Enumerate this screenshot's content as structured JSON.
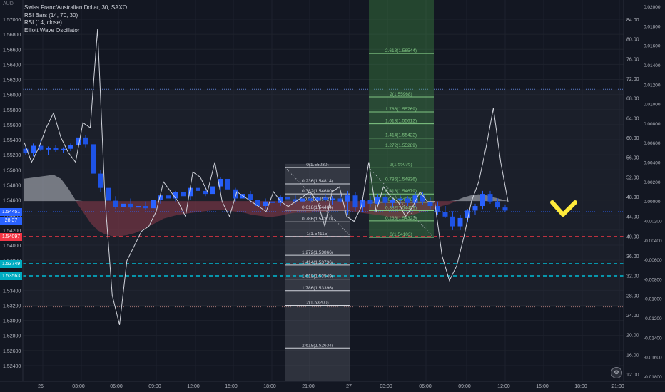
{
  "window": {
    "unit_label": "AUD"
  },
  "legend": {
    "symbol": "Swiss Franc/Australian Dollar, 30, SAXO",
    "indicators": [
      "RSI Bars (14, 70, 30)",
      "RSI (14, close)",
      "Elliott Wave Oscillator"
    ]
  },
  "price_tags": {
    "current": "1.54451",
    "countdown": "28:37",
    "red_level": "1.54097",
    "cyan1": "1.53749",
    "cyan2": "1.53563"
  },
  "colors": {
    "background": "#131722",
    "bull": "#2962ff",
    "bear": "#1e53e5",
    "red_line": "#f23645",
    "cyan_line": "#00bcd4",
    "fib_green": "#81c784",
    "fib_white": "#d1d4dc",
    "check_mark": "#ffeb3b"
  },
  "chart_data": {
    "type": "candlestick",
    "price_axis": {
      "min": 1.522,
      "max": 1.572,
      "ticks": [
        "1.57000",
        "1.56800",
        "1.56600",
        "1.56400",
        "1.56200",
        "1.56000",
        "1.55800",
        "1.55600",
        "1.55400",
        "1.55200",
        "1.55000",
        "1.54800",
        "1.54600",
        "1.54400",
        "1.54200",
        "1.54000",
        "1.53800",
        "1.53600",
        "1.53400",
        "1.53200",
        "1.53000",
        "1.52800",
        "1.52600",
        "1.52400"
      ]
    },
    "rsi_axis": {
      "ticks": [
        "84.00",
        "80.00",
        "76.00",
        "72.00",
        "68.00",
        "64.00",
        "60.00",
        "56.00",
        "52.00",
        "48.00",
        "44.00",
        "40.00",
        "36.00",
        "32.00",
        "28.00",
        "24.00",
        "20.00",
        "16.00",
        "12.00"
      ]
    },
    "osc_axis": {
      "ticks": [
        "0.02000",
        "0.01800",
        "0.01600",
        "0.01400",
        "0.01200",
        "0.01000",
        "0.00800",
        "0.00600",
        "0.00400",
        "0.00200",
        "0.00000",
        "-0.00200",
        "-0.00400",
        "-0.00600",
        "-0.00800",
        "-0.01000",
        "-0.01200",
        "-0.01400",
        "-0.01600",
        "-0.01800"
      ]
    },
    "time_axis": [
      "26",
      "03:00",
      "06:00",
      "09:00",
      "12:00",
      "15:00",
      "18:00",
      "21:00",
      "27",
      "03:00",
      "06:00",
      "09:00",
      "12:00",
      "15:00",
      "18:00",
      "21:00"
    ],
    "candles": [
      [
        1.5528,
        1.5532,
        1.552,
        1.5522
      ],
      [
        1.5522,
        1.5535,
        1.5518,
        1.5532
      ],
      [
        1.5532,
        1.554,
        1.5525,
        1.5527
      ],
      [
        1.5527,
        1.5531,
        1.552,
        1.5529
      ],
      [
        1.5529,
        1.5533,
        1.5524,
        1.5526
      ],
      [
        1.5526,
        1.553,
        1.5522,
        1.5528
      ],
      [
        1.5528,
        1.5535,
        1.5525,
        1.5533
      ],
      [
        1.5533,
        1.5545,
        1.553,
        1.5543
      ],
      [
        1.5543,
        1.5546,
        1.553,
        1.5534
      ],
      [
        1.5534,
        1.5536,
        1.549,
        1.5495
      ],
      [
        1.5495,
        1.55,
        1.547,
        1.5476
      ],
      [
        1.5476,
        1.548,
        1.5455,
        1.5459
      ],
      [
        1.5459,
        1.5465,
        1.5448,
        1.5451
      ],
      [
        1.5451,
        1.546,
        1.5445,
        1.5455
      ],
      [
        1.5455,
        1.5462,
        1.5448,
        1.545
      ],
      [
        1.545,
        1.5456,
        1.5442,
        1.5452
      ],
      [
        1.5452,
        1.5458,
        1.5447,
        1.5449
      ],
      [
        1.5449,
        1.5462,
        1.5446,
        1.546
      ],
      [
        1.546,
        1.5468,
        1.5455,
        1.5466
      ],
      [
        1.5466,
        1.547,
        1.5458,
        1.5462
      ],
      [
        1.5462,
        1.5472,
        1.5458,
        1.547
      ],
      [
        1.547,
        1.5475,
        1.5462,
        1.5465
      ],
      [
        1.5465,
        1.5478,
        1.546,
        1.5476
      ],
      [
        1.5476,
        1.5482,
        1.5468,
        1.5472
      ],
      [
        1.5472,
        1.5478,
        1.5465,
        1.5468
      ],
      [
        1.5468,
        1.548,
        1.5465,
        1.5478
      ],
      [
        1.5478,
        1.549,
        1.547,
        1.5488
      ],
      [
        1.5488,
        1.5492,
        1.547,
        1.5474
      ],
      [
        1.5474,
        1.5476,
        1.5458,
        1.5462
      ],
      [
        1.5462,
        1.5472,
        1.5455,
        1.5468
      ],
      [
        1.5468,
        1.5472,
        1.5456,
        1.546
      ],
      [
        1.546,
        1.5465,
        1.5448,
        1.5452
      ],
      [
        1.5452,
        1.5462,
        1.5448,
        1.5458
      ],
      [
        1.5458,
        1.5464,
        1.545,
        1.5456
      ],
      [
        1.5456,
        1.5466,
        1.5452,
        1.5464
      ],
      [
        1.5464,
        1.547,
        1.5458,
        1.5461
      ],
      [
        1.5461,
        1.5466,
        1.5455,
        1.5458
      ],
      [
        1.5458,
        1.5464,
        1.5454,
        1.5462
      ],
      [
        1.5462,
        1.5467,
        1.5456,
        1.5459
      ],
      [
        1.5459,
        1.5466,
        1.5455,
        1.5463
      ],
      [
        1.5463,
        1.5468,
        1.5458,
        1.546
      ],
      [
        1.546,
        1.5465,
        1.5454,
        1.5462
      ],
      [
        1.5462,
        1.5468,
        1.5456,
        1.5458
      ],
      [
        1.5458,
        1.5472,
        1.544,
        1.5466
      ],
      [
        1.5466,
        1.547,
        1.5445,
        1.545
      ],
      [
        1.545,
        1.5462,
        1.5444,
        1.546
      ],
      [
        1.546,
        1.5465,
        1.545,
        1.5455
      ],
      [
        1.5455,
        1.5468,
        1.5452,
        1.5464
      ],
      [
        1.5464,
        1.5468,
        1.5452,
        1.5456
      ],
      [
        1.5456,
        1.5462,
        1.545,
        1.546
      ],
      [
        1.546,
        1.5466,
        1.5455,
        1.5462
      ],
      [
        1.5462,
        1.5465,
        1.5452,
        1.5456
      ],
      [
        1.5456,
        1.547,
        1.545,
        1.5466
      ],
      [
        1.5466,
        1.547,
        1.5454,
        1.5458
      ],
      [
        1.5458,
        1.5463,
        1.5448,
        1.5452
      ],
      [
        1.5452,
        1.5458,
        1.544,
        1.5444
      ],
      [
        1.5444,
        1.5452,
        1.5436,
        1.5438
      ],
      [
        1.5438,
        1.5445,
        1.542,
        1.5425
      ],
      [
        1.5425,
        1.544,
        1.542,
        1.5436
      ],
      [
        1.5436,
        1.5448,
        1.543,
        1.5446
      ],
      [
        1.5446,
        1.5455,
        1.544,
        1.5452
      ],
      [
        1.5452,
        1.5472,
        1.5448,
        1.5468
      ],
      [
        1.5468,
        1.5472,
        1.5455,
        1.5458
      ],
      [
        1.5458,
        1.5462,
        1.5448,
        1.545
      ],
      [
        1.545,
        1.5454,
        1.5444,
        1.5446
      ]
    ],
    "fib_left": {
      "levels": [
        [
          "0(1.55030)",
          1.5503
        ],
        [
          "0.236(1.54814)",
          1.54814
        ],
        [
          "0.382(1.54680)",
          1.5468
        ],
        [
          "0.5(1.54572)",
          1.54572
        ],
        [
          "0.618(1.54464)",
          1.54464
        ],
        [
          "0.786(1.54310)",
          1.5431
        ],
        [
          "1(1.54115)",
          1.54115
        ],
        [
          "1.272(1.53866)",
          1.53866
        ],
        [
          "1.414(1.53736)",
          1.53736
        ],
        [
          "1.618(1.53549)",
          1.53549
        ],
        [
          "1.786(1.53396)",
          1.53396
        ],
        [
          "2(1.53200)",
          1.532
        ],
        [
          "2.618(1.52634)",
          1.52634
        ]
      ]
    },
    "fib_right": {
      "levels": [
        [
          "2.618(1.56544)",
          1.56544
        ],
        [
          "2(1.55968)",
          1.55968
        ],
        [
          "1.786(1.55769)",
          1.55769
        ],
        [
          "1.618(1.55612)",
          1.55612
        ],
        [
          "1.414(1.55422)",
          1.55422
        ],
        [
          "1.272(1.55289)",
          1.55289
        ],
        [
          "1(1.55035)",
          1.55035
        ],
        [
          "0.786(1.54836)",
          1.54836
        ],
        [
          "0.618(1.54679)",
          1.54679
        ],
        [
          "0.5(1.54569)",
          1.54569
        ],
        [
          "0.382(1.54459)",
          1.54459
        ],
        [
          "0.236(1.54323)",
          1.54323
        ],
        [
          "0(1.54103)",
          1.54103
        ]
      ]
    },
    "rsi_line": [
      59,
      55,
      58,
      62,
      65,
      60,
      57,
      55,
      63,
      62,
      82,
      48,
      28,
      22,
      35,
      38,
      41,
      42,
      45,
      51,
      49,
      47,
      44,
      53,
      52,
      49,
      55,
      47,
      44,
      49,
      48,
      47,
      46,
      45,
      49,
      47,
      46,
      47,
      48,
      49,
      47,
      42,
      49,
      50,
      44,
      43,
      46,
      55,
      45,
      50,
      48,
      47,
      44,
      46,
      49,
      47,
      47,
      36,
      31,
      34,
      40,
      47,
      51,
      58,
      66,
      55,
      47
    ],
    "oscillator": [
      0.0023,
      0.0024,
      0.0025,
      0.0026,
      0.0027,
      0.0023,
      0.0013,
      0.0001,
      -0.0011,
      -0.0022,
      -0.003,
      -0.0034,
      -0.0036,
      -0.0036,
      -0.0035,
      -0.0033,
      -0.003,
      -0.0026,
      -0.0022,
      -0.0018,
      -0.0016,
      -0.0014,
      -0.0013,
      -0.0012,
      -0.0011,
      -0.001,
      -0.0009,
      -0.0009,
      -0.001,
      -0.0011,
      -0.0012,
      -0.0014,
      -0.0015,
      -0.0016,
      -0.0016,
      -0.0015,
      -0.0013,
      -0.0012,
      -0.0012,
      -0.0012,
      -0.0011,
      -0.0011,
      -0.001,
      -0.001,
      -0.001,
      -0.0011,
      -0.0012,
      -0.0013,
      -0.0014,
      -0.0015,
      -0.0017,
      -0.0018,
      -0.0016,
      -0.0014,
      -0.0012,
      -0.001,
      -0.0008,
      -0.0005,
      -0.0003,
      0.0001,
      0.0004,
      0.0006,
      0.0007,
      0.0006,
      0.0004,
      0.0002,
      0.0
    ]
  }
}
